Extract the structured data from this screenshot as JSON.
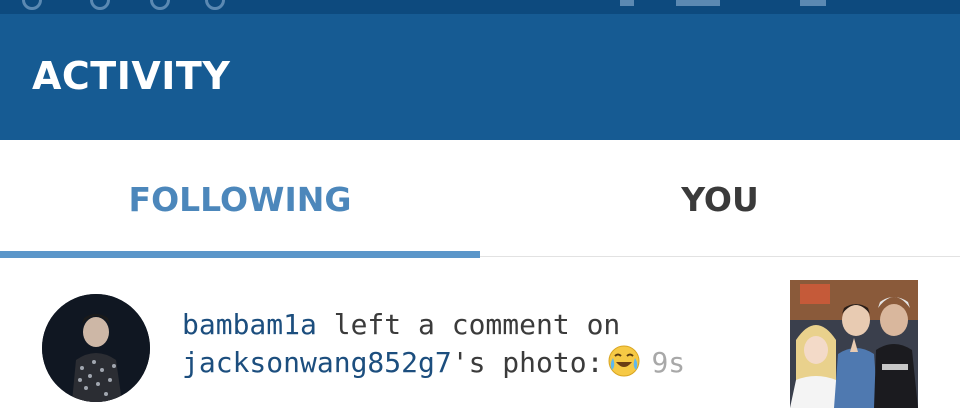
{
  "header": {
    "title": "ACTIVITY"
  },
  "tabs": [
    {
      "label": "FOLLOWING",
      "active": true
    },
    {
      "label": "YOU",
      "active": false
    }
  ],
  "activity": {
    "actor": "bambam1a",
    "action": " left a comment on",
    "target_user": "jacksonwang852g7",
    "suffix": "'s photo:",
    "emoji": "crying-laughing-emoji",
    "time": "9s"
  },
  "colors": {
    "app_bar": "#165b93",
    "status_bar": "#0d4a7e",
    "active_tab": "#4c87bb",
    "inactive_tab": "#3a3a3a",
    "username": "#1c4e7e",
    "timestamp": "#a8a8a8"
  }
}
